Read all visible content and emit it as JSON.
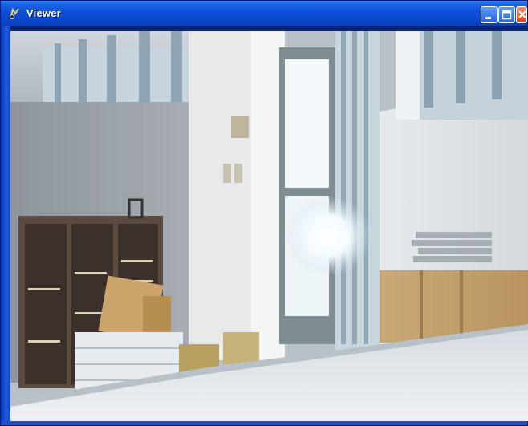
{
  "window": {
    "title": "Viewer",
    "icon": "viewer-app-icon",
    "controls": [
      "minimize-icon",
      "maximize-icon",
      "close-icon"
    ]
  },
  "camera_feed": {
    "description_icon": "webcam-video-frame"
  },
  "colors": {
    "titlebar": "#0a46c8",
    "close_button": "#d8401a",
    "frame_border": "#0a3fb4"
  }
}
